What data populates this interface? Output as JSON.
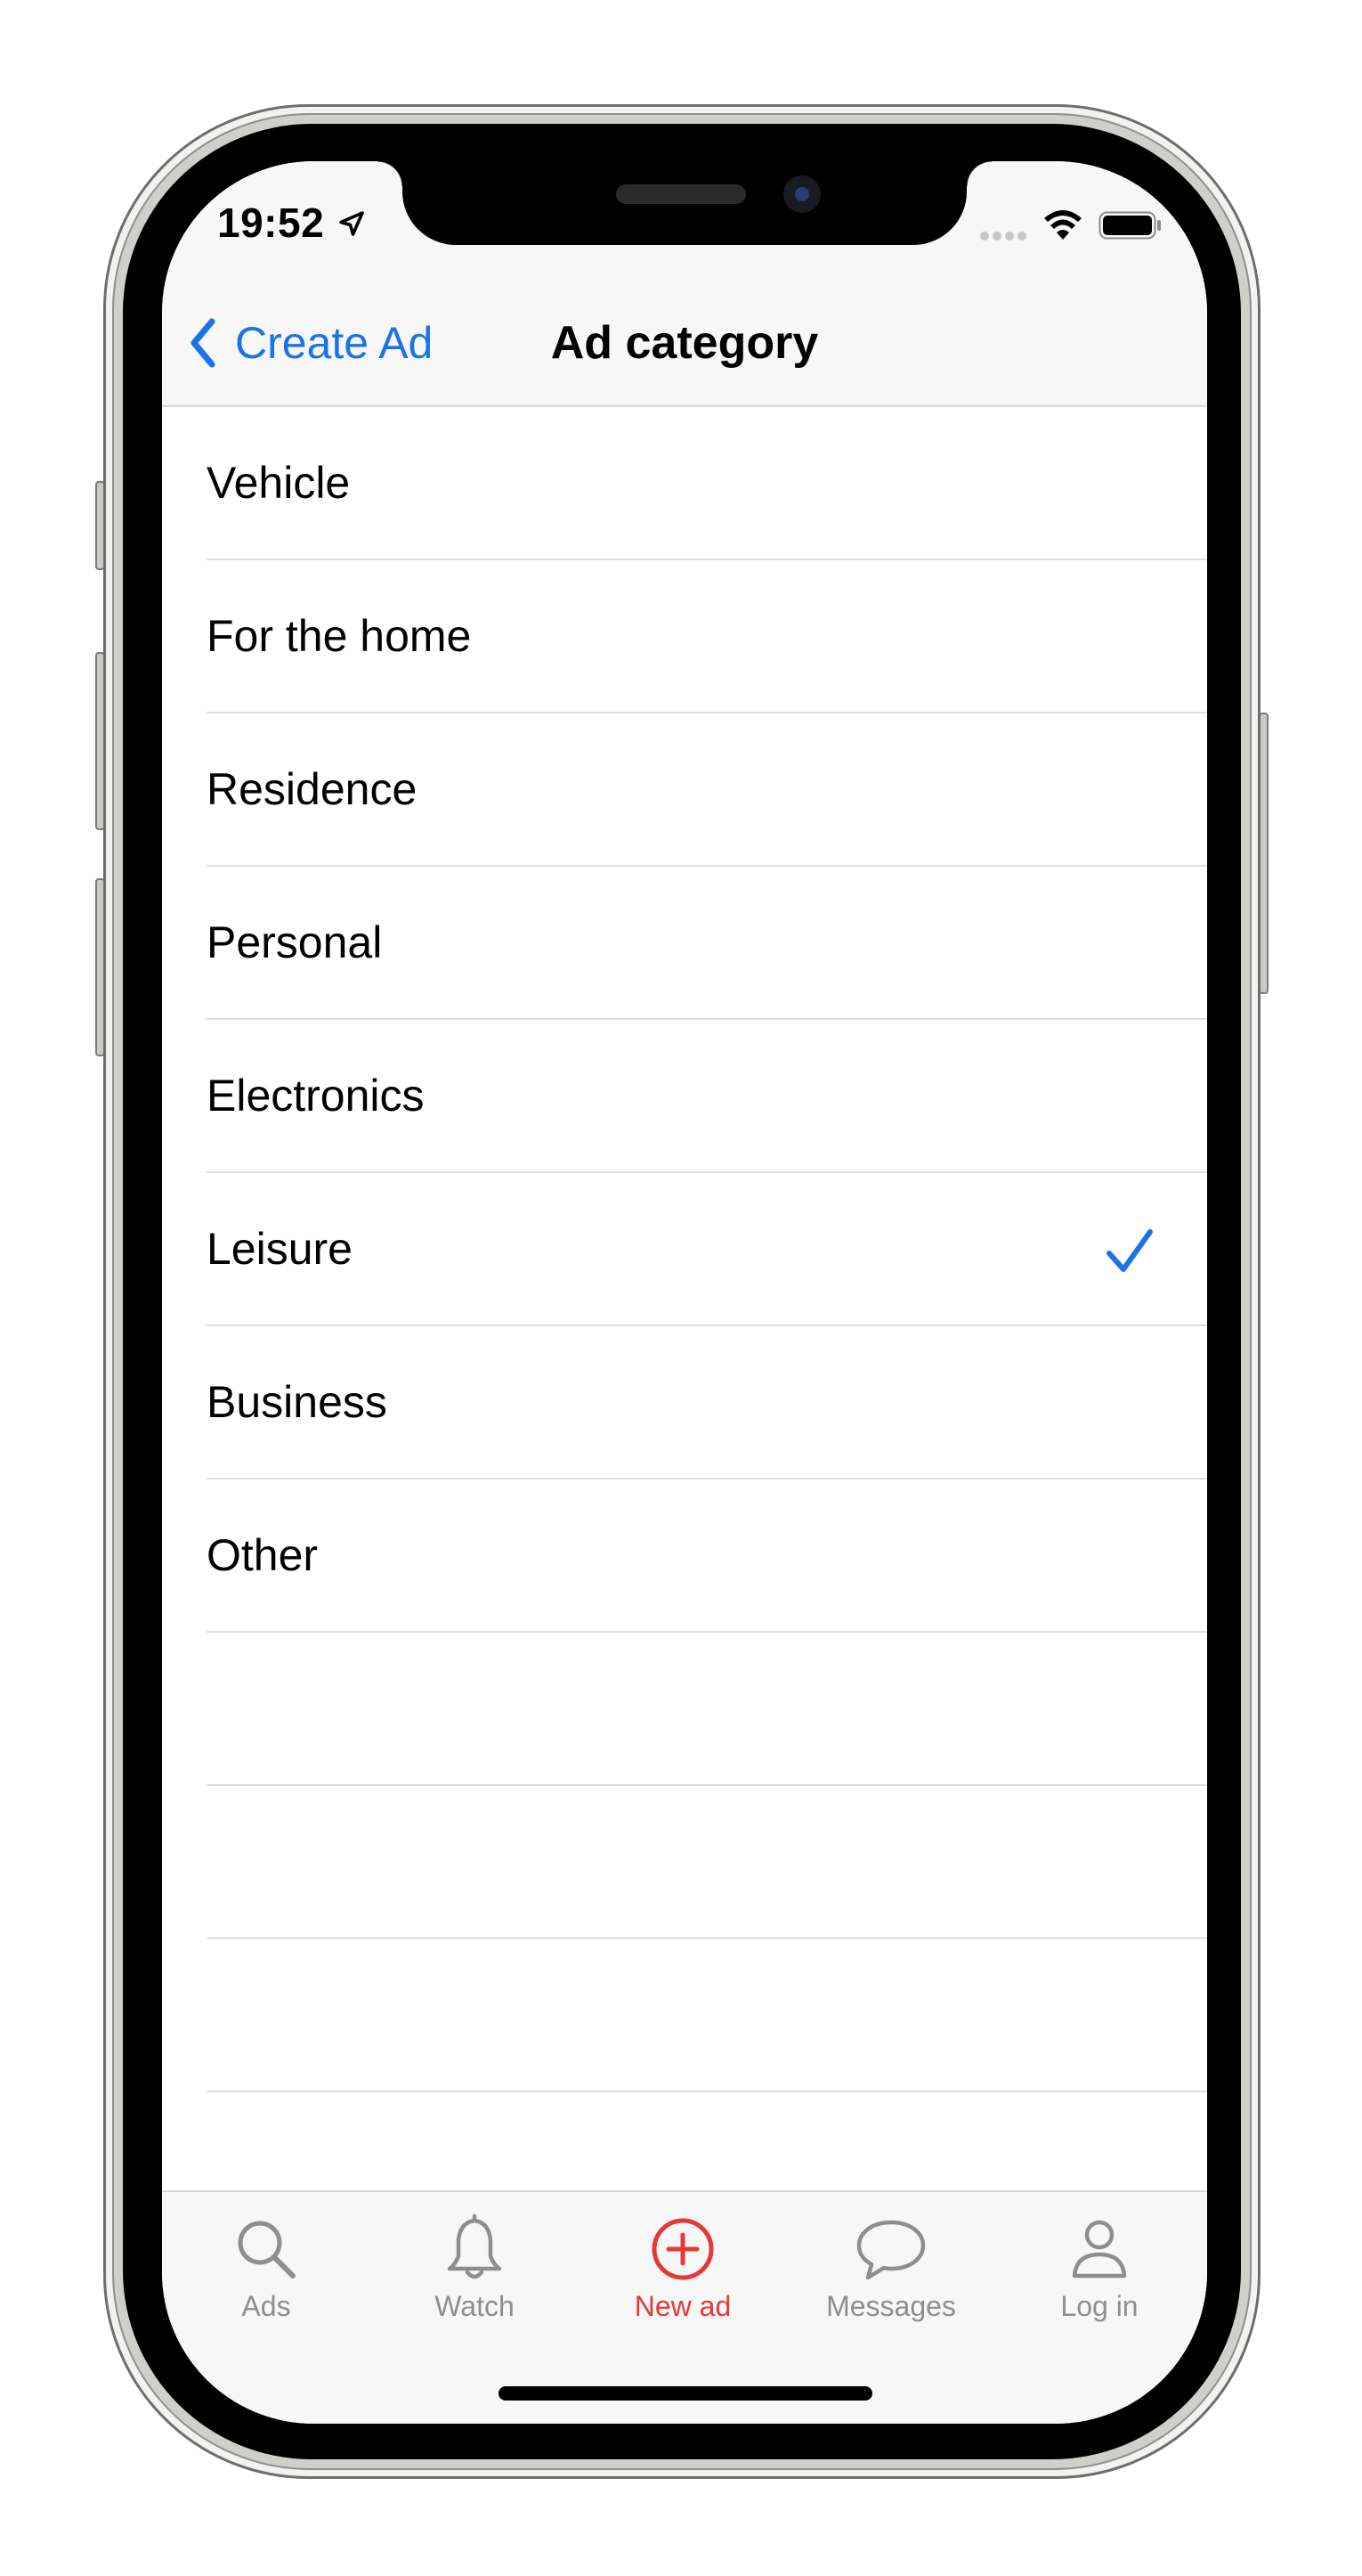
{
  "status": {
    "time": "19:52"
  },
  "nav": {
    "back_label": "Create Ad",
    "title": "Ad category"
  },
  "categories": [
    {
      "label": "Vehicle",
      "selected": false
    },
    {
      "label": "For the home",
      "selected": false
    },
    {
      "label": "Residence",
      "selected": false
    },
    {
      "label": "Personal",
      "selected": false
    },
    {
      "label": "Electronics",
      "selected": false
    },
    {
      "label": "Leisure",
      "selected": true
    },
    {
      "label": "Business",
      "selected": false
    },
    {
      "label": "Other",
      "selected": false
    }
  ],
  "tabs": [
    {
      "label": "Ads",
      "icon": "search-icon",
      "active": false
    },
    {
      "label": "Watch",
      "icon": "bell-icon",
      "active": false
    },
    {
      "label": "New ad",
      "icon": "plus-circle-icon",
      "active": true
    },
    {
      "label": "Messages",
      "icon": "chat-bubble-icon",
      "active": false
    },
    {
      "label": "Log in",
      "icon": "person-icon",
      "active": false
    }
  ],
  "colors": {
    "accent": "#1a73e8",
    "active_tab": "#e53935",
    "inactive_tab": "#8e8e8e"
  }
}
